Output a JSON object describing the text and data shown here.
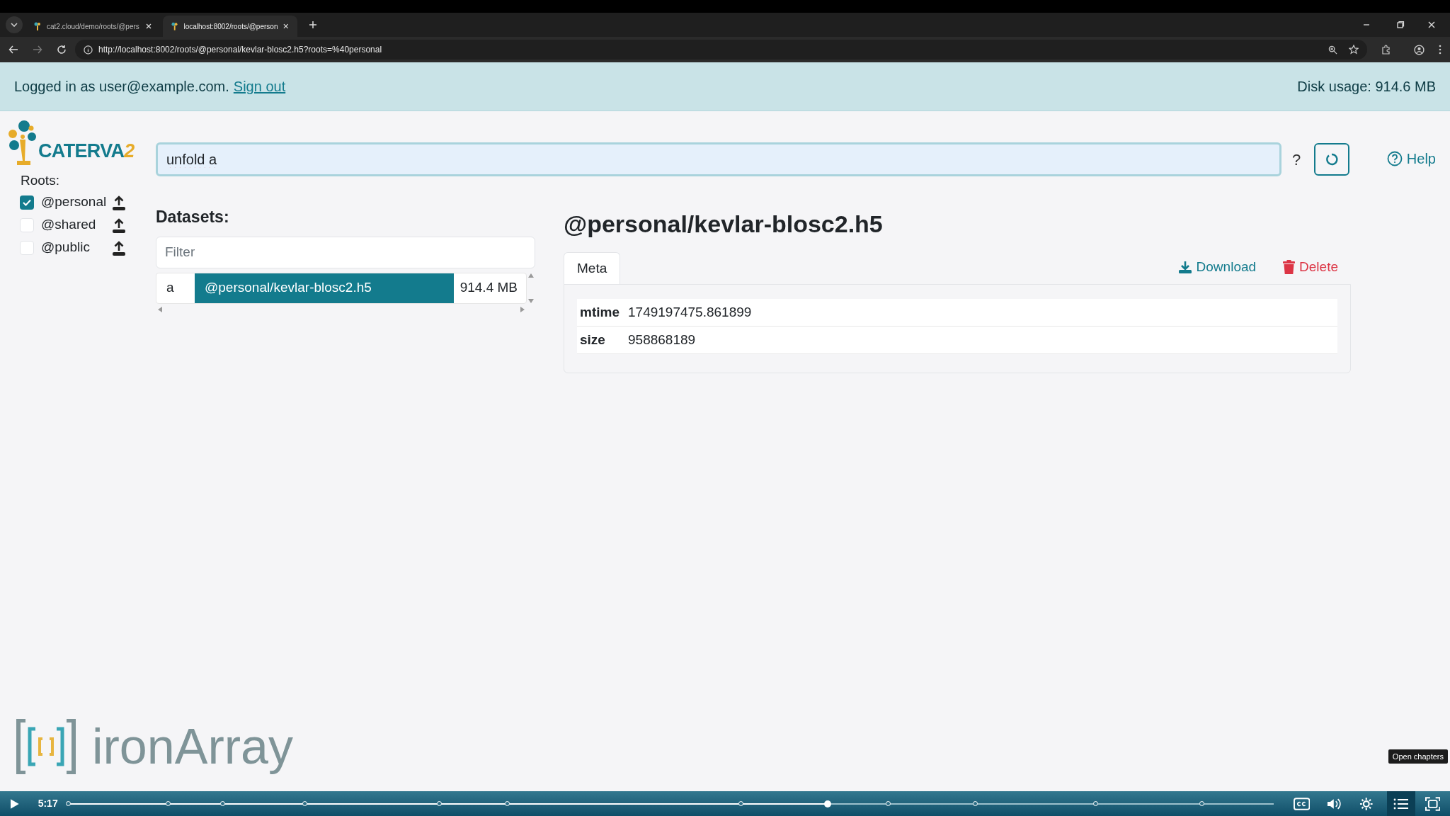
{
  "browser": {
    "tabs": [
      {
        "title": "cat2.cloud/demo/roots/@pers",
        "selected": false
      },
      {
        "title": "localhost:8002/roots/@person",
        "selected": true
      }
    ],
    "address": "http://localhost:8002/roots/@personal/kevlar-blosc2.h5?roots=%40personal"
  },
  "banner": {
    "login_text": "Logged in as user@example.com.",
    "sign_out": "Sign out",
    "disk_usage": "Disk usage: 914.6 MB"
  },
  "logo": {
    "text": "CATERVA2"
  },
  "search": {
    "value": "unfold a",
    "help_button": "?"
  },
  "help_link": "Help",
  "roots": {
    "label": "Roots:",
    "items": [
      {
        "name": "@personal",
        "checked": true
      },
      {
        "name": "@shared",
        "checked": false
      },
      {
        "name": "@public",
        "checked": false
      }
    ]
  },
  "datasets": {
    "heading": "Datasets:",
    "filter_placeholder": "Filter",
    "rows": [
      {
        "column_1": "a",
        "path": "@personal/kevlar-blosc2.h5",
        "size": "914.4 MB",
        "selected": true
      }
    ]
  },
  "dataset": {
    "title": "@personal/kevlar-blosc2.h5",
    "tabs": [
      {
        "label": "Meta",
        "selected": true
      }
    ],
    "actions": [
      {
        "label": "Download",
        "kind": "download"
      },
      {
        "label": "Delete",
        "kind": "delete"
      }
    ],
    "meta": [
      {
        "key": "mtime",
        "value": "1749197475.861899"
      },
      {
        "key": "size",
        "value": "958868189"
      }
    ]
  },
  "footer_logo": {
    "text": "**iron**Array"
  },
  "video_player": {
    "time": "5:17",
    "level": 0.63,
    "tooltip": "Open chapters"
  }
}
